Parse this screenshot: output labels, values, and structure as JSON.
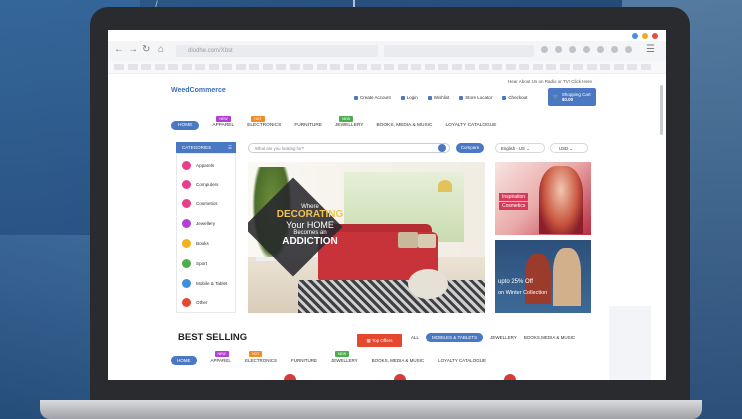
{
  "decor": {
    "arrow": "/"
  },
  "window": {
    "dot_colors": [
      "#4a90e2",
      "#f5a623",
      "#e94b3c"
    ]
  },
  "browser": {
    "url": "dlodhe.com/Xbst"
  },
  "header": {
    "logo": "WeedCommerce",
    "topline": "Hear About Us on Radio or TV! Click Here",
    "links": [
      "Create Account",
      "Login",
      "Wishlist",
      "Store Locator",
      "Checkout"
    ],
    "cart_label": "Shopping Cart",
    "cart_amount": "$0.00"
  },
  "nav": {
    "items": [
      "HOME",
      "APPAREL",
      "ELECTRONICS",
      "FURNITURE",
      "JEWELLERY",
      "BOOKS, MEDIA & MUSIC",
      "LOYALTY CATALOGUE"
    ],
    "badges": [
      {
        "text": "NEW",
        "color": "#b33fd6"
      },
      {
        "text": "HOT",
        "color": "#f08c2a"
      },
      {
        "text": "NEW",
        "color": "#4cae4c"
      }
    ]
  },
  "sidebar": {
    "heading": "CATEGORIES",
    "items": [
      {
        "label": "Apparels",
        "color": "#e83e8c"
      },
      {
        "label": "Computers",
        "color": "#e83e8c"
      },
      {
        "label": "Cosmetics",
        "color": "#e83e8c"
      },
      {
        "label": "Jewellery",
        "color": "#b33fd6"
      },
      {
        "label": "Books",
        "color": "#f0b21f"
      },
      {
        "label": "Sport",
        "color": "#4cae4c"
      },
      {
        "label": "Mobile & Tablet",
        "color": "#3d8ee0"
      },
      {
        "label": "Other",
        "color": "#e4492f"
      }
    ]
  },
  "search": {
    "placeholder": "What are you looking for?",
    "compare": "Compare",
    "language": "English - US",
    "currency": "USD"
  },
  "hero": {
    "line1": "Where",
    "line2": "DECORATING",
    "line3": "Your HOME",
    "line4": "Becomes an",
    "line5": "ADDICTION"
  },
  "promo1": {
    "line1": "Inspiration",
    "line2": "Cosmetics"
  },
  "promo2": {
    "line1": "upto 25% Off",
    "line2": "on Winter Collection"
  },
  "best": {
    "title": "BEST SELLING",
    "top_offers": "Top Offers",
    "filters": [
      "ALL",
      "MOBILES & TABLETS",
      "JEWELLERY",
      "BOOKS,MEDIA & MUSIC"
    ]
  }
}
